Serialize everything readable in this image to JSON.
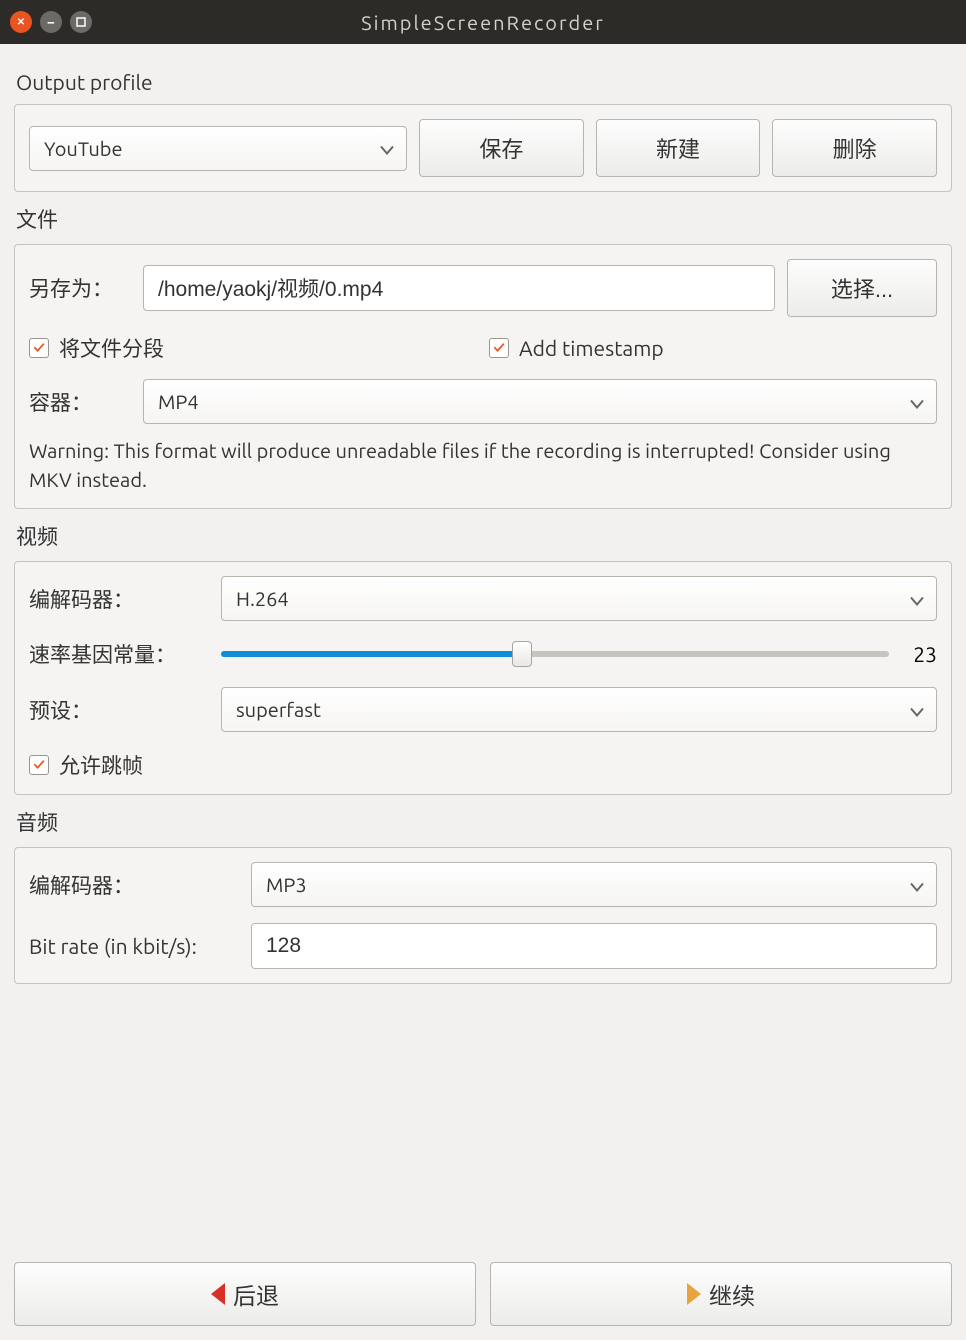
{
  "window": {
    "title": "SimpleScreenRecorder"
  },
  "output_profile": {
    "label": "Output profile",
    "value": "YouTube",
    "save": "保存",
    "new": "新建",
    "delete": "删除"
  },
  "file": {
    "label": "文件",
    "save_as_label": "另存为：",
    "path": "/home/yaokj/视频/0.mp4",
    "browse": "选择...",
    "segment_checkbox": "将文件分段",
    "timestamp_checkbox": "Add timestamp",
    "container_label": "容器：",
    "container_value": "MP4",
    "warning": "Warning: This format will produce unreadable files if the recording is interrupted! Consider using MKV instead."
  },
  "video": {
    "label": "视频",
    "codec_label": "编解码器：",
    "codec_value": "H.264",
    "crf_label": "速率基因常量：",
    "crf_value": "23",
    "crf_percent": 45,
    "preset_label": "预设：",
    "preset_value": "superfast",
    "skip_checkbox": "允许跳帧"
  },
  "audio": {
    "label": "音频",
    "codec_label": "编解码器：",
    "codec_value": "MP3",
    "bitrate_label": "Bit rate (in kbit/s):",
    "bitrate_value": "128"
  },
  "nav": {
    "back": "后退",
    "continue": "继续"
  }
}
